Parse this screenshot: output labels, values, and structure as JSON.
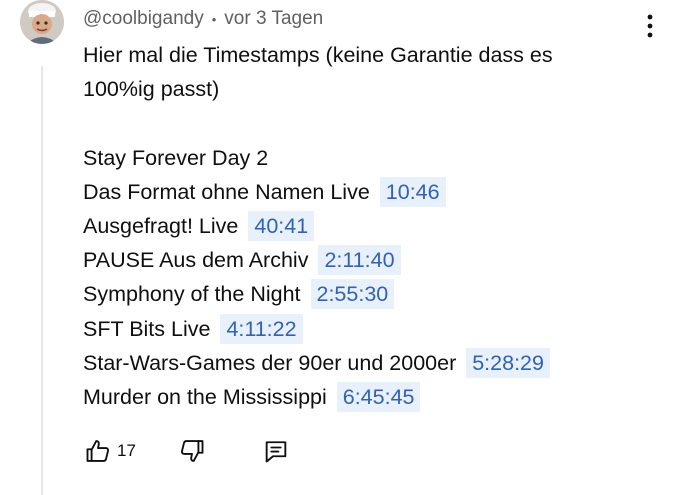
{
  "comment": {
    "author": "@coolbigandy",
    "separator": "•",
    "time": "vor 3 Tagen",
    "intro_line1": "Hier mal die Timestamps (keine Garantie dass es",
    "intro_line2": "100%ig passt)",
    "heading": "Stay Forever Day 2",
    "entries": [
      {
        "title": "Das Format ohne Namen Live",
        "timestamp": "10:46"
      },
      {
        "title": "Ausgefragt! Live",
        "timestamp": "40:41"
      },
      {
        "title": "PAUSE Aus dem Archiv",
        "timestamp": "2:11:40"
      },
      {
        "title": "Symphony of the Night",
        "timestamp": "2:55:30"
      },
      {
        "title": "SFT Bits Live",
        "timestamp": "4:11:22"
      },
      {
        "title": "Star-Wars-Games der 90er und 2000er",
        "timestamp": "5:28:29"
      },
      {
        "title": "Murder on the Mississippi",
        "timestamp": "6:45:45"
      }
    ]
  },
  "actions": {
    "like_icon": "thumbs-up-icon",
    "like_count": "17",
    "dislike_icon": "thumbs-down-icon",
    "reply_icon": "reply-comment-icon"
  },
  "menu_icon": "more-vertical-icon",
  "colors": {
    "timestamp_text": "#3162b4",
    "timestamp_bg": "#e8f0fb",
    "meta_text": "#606060",
    "body_text": "#0f0f0f"
  }
}
